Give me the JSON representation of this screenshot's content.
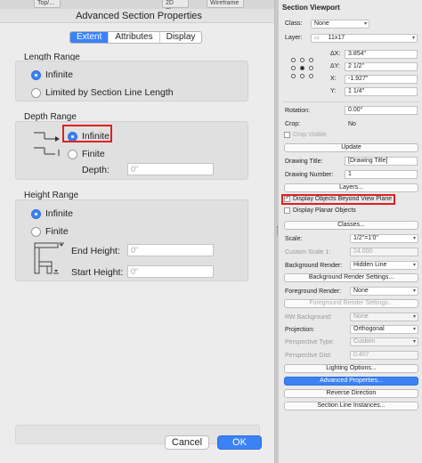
{
  "toolbar_strip": {
    "item1": "Top/...",
    "item2": "2D Pl...",
    "item3": "Wireframe"
  },
  "dialog": {
    "title": "Advanced Section Properties",
    "tabs": [
      {
        "label": "Extent"
      },
      {
        "label": "Attributes"
      },
      {
        "label": "Display"
      }
    ],
    "length_range": {
      "label": "Length Range",
      "options": [
        "Infinite",
        "Limited by Section Line Length"
      ],
      "selected": "Infinite"
    },
    "depth_range": {
      "label": "Depth Range",
      "options": [
        "Infinite",
        "Finite"
      ],
      "selected": "Infinite",
      "depth_label": "Depth:",
      "depth_placeholder": "0\""
    },
    "height_range": {
      "label": "Height Range",
      "options": [
        "Infinite",
        "Finite"
      ],
      "selected": "Infinite",
      "end_height_label": "End Height:",
      "end_height_placeholder": "0\"",
      "start_height_label": "Start Height:",
      "start_height_placeholder": "0\""
    },
    "cancel_label": "Cancel",
    "ok_label": "OK",
    "accent_color": "#3b82f6",
    "highlight_color": "#e02020"
  },
  "oip": {
    "title": "Section Viewport",
    "class_label": "Class:",
    "class_value": "None",
    "layer_label": "Layer:",
    "layer_value": "11x17",
    "dx_label": "ΔX:",
    "dx_value": "3.854\"",
    "dy_label": "ΔY:",
    "dy_value": "2 1/2\"",
    "x_label": "X:",
    "x_value": "-1.927\"",
    "y_label": "Y:",
    "y_value": "1 1/4\"",
    "rotation_label": "Rotation:",
    "rotation_value": "0.00°",
    "crop_label": "Crop:",
    "crop_value": "No",
    "crop_visible_label": "Crop Visible",
    "update_label": "Update",
    "drawing_title_label": "Drawing Title:",
    "drawing_title_value": "[Drawing Title]",
    "drawing_number_label": "Drawing Number:",
    "drawing_number_value": "1",
    "layers_label": "Layers...",
    "display_beyond_label": "Display Objects Beyond View Plane",
    "display_planar_label": "Display Planar Objects",
    "classes_label": "Classes...",
    "scale_label": "Scale:",
    "scale_value": "1/2\"=1'0\"",
    "custom_scale_label": "Custom Scale 1:",
    "custom_scale_value": "24.000",
    "background_render_label": "Background Render:",
    "background_render_value": "Hidden Line",
    "background_render_settings_label": "Background Render Settings...",
    "foreground_render_label": "Foreground Render:",
    "foreground_render_value": "None",
    "foreground_render_settings_label": "Foreground Render Settings...",
    "rw_background_label": "RW Background:",
    "rw_background_value": "None",
    "projection_label": "Projection:",
    "projection_value": "Orthogonal",
    "perspective_type_label": "Perspective Type:",
    "perspective_type_value": "Custom",
    "perspective_dist_label": "Perspective Dist:",
    "perspective_dist_value": "0.407",
    "lighting_options_label": "Lighting Options...",
    "advanced_properties_label": "Advanced Properties...",
    "reverse_direction_label": "Reverse Direction",
    "section_line_instances_label": "Section Line Instances..."
  }
}
